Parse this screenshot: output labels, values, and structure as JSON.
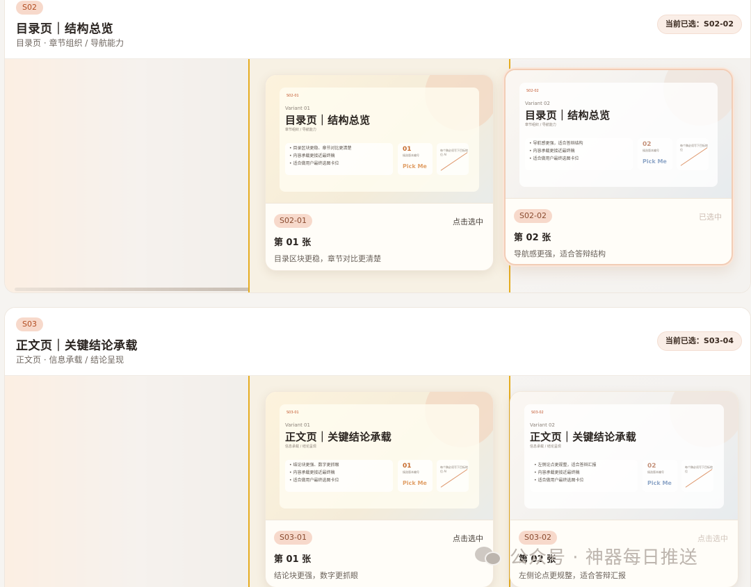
{
  "sections": [
    {
      "id": "S02",
      "title": "目录页｜结构总览",
      "subtitle": "目录页 · 章节组织 / 导航能力",
      "current": "当前已选：S02-02",
      "cards": [
        {
          "thumb": {
            "code": "S02-01",
            "variant": "Variant 01",
            "title": "目录页｜结构总览",
            "subtitle": "章节组织 / 导航能力",
            "bullets": [
              "• 目录区块更稳、章节对比更清楚",
              "• 内容承载更接近最终稿",
              "• 适合做用户最终选图卡位"
            ],
            "num": "01",
            "num_label": "候选版本编号",
            "pick": "Pick Me",
            "note": "每个稿必须写下目标地位 AI"
          },
          "id": "S02-01",
          "action": "点击选中",
          "number": "第 01 张",
          "desc": "目录区块更稳，章节对比更清楚"
        },
        {
          "thumb": {
            "code": "S02-02",
            "variant": "Variant 02",
            "title": "目录页｜结构总览",
            "subtitle": "章节组织 / 导航能力",
            "bullets": [
              "• 导航感更强，适合答辩结构",
              "• 内容承载更接近最终稿",
              "• 适合做用户最终选图卡位"
            ],
            "num": "02",
            "num_label": "候选版本编号",
            "pick": "Pick Me",
            "note": "每个稿必须写下目标地位"
          },
          "id": "S02-02",
          "action": "已选中",
          "number": "第 02 张",
          "desc": "导航感更强，适合答辩结构"
        }
      ]
    },
    {
      "id": "S03",
      "title": "正文页｜关键结论承载",
      "subtitle": "正文页 · 信息承载 / 结论呈现",
      "current": "当前已选：S03-04",
      "cards": [
        {
          "thumb": {
            "code": "S03-01",
            "variant": "Variant 01",
            "title": "正文页｜关键结论承载",
            "subtitle": "信息承载 / 结论呈现",
            "bullets": [
              "• 结论块更强、数字更抓眼",
              "• 内容承载更接近最终稿",
              "• 适合做用户最终选图卡位"
            ],
            "num": "01",
            "num_label": "候选版本编号",
            "pick": "Pick Me",
            "note": "每个稿必须写下目标地位 AI"
          },
          "id": "S03-01",
          "action": "点击选中",
          "number": "第 01 张",
          "desc": "结论块更强，数字更抓眼"
        },
        {
          "thumb": {
            "code": "S03-02",
            "variant": "Variant 02",
            "title": "正文页｜关键结论承载",
            "subtitle": "信息承载 / 结论呈现",
            "bullets": [
              "• 左侧论点更规整，适合答辩汇报",
              "• 内容承载更接近最终稿",
              "• 适合做用户最终选图卡位"
            ],
            "num": "02",
            "num_label": "候选版本编号",
            "pick": "Pick Me",
            "note": "每个稿必须写下目标地位"
          },
          "id": "S03-02",
          "action": "点击选中",
          "number": "第 02 张",
          "desc": "左侧论点更规整，适合答辩汇报"
        }
      ]
    }
  ],
  "watermark": "公众号 · 神器每日推送",
  "colors": {
    "accent_line": "#e5ac20",
    "badge_bg": "#f7d9cb",
    "selected_border": "#f2cdb6"
  }
}
